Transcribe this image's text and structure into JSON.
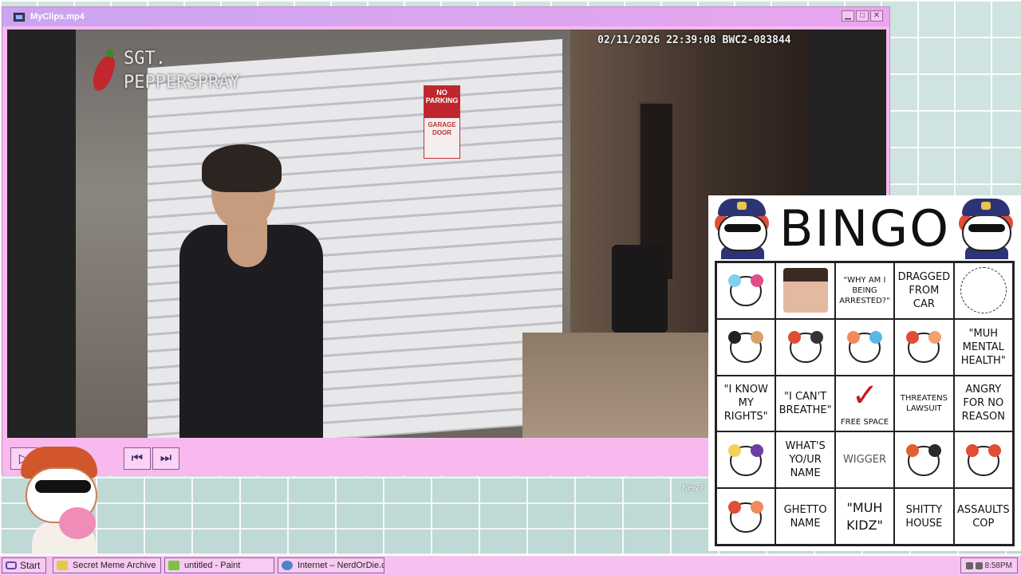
{
  "window": {
    "title": "MyClips.mp4",
    "controls": {
      "minimize": "▁",
      "maximize": "□",
      "close": "✕"
    }
  },
  "video": {
    "watermark_line1": "SGT.",
    "watermark_line2": "PEPPERSPRAY",
    "timestamp": "02/11/2026 22:39:08 BWC2-083844",
    "sign_top": "NO PARKING",
    "sign_bottom": "GARAGE DOOR"
  },
  "player_controls": {
    "play_icon": "▷",
    "prev_icon": "⏮",
    "next_icon": "⏭"
  },
  "bingo": {
    "title": "BINGO",
    "free_space_label": "FREE SPACE",
    "cells": [
      {
        "type": "image",
        "icon": "cat-sticker-pink"
      },
      {
        "type": "image",
        "icon": "crying-woman-photo"
      },
      {
        "type": "text",
        "style": "small",
        "text": "\"WHY AM I BEING ARRESTED?\""
      },
      {
        "type": "text",
        "style": "normal",
        "text": "DRAGGED FROM CAR"
      },
      {
        "type": "image",
        "icon": "sketch-drawing"
      },
      {
        "type": "image",
        "icon": "cat-sticker-black-hair"
      },
      {
        "type": "image",
        "icon": "cat-sticker-steering-wheel"
      },
      {
        "type": "image",
        "icon": "cat-sticker-orange-hair"
      },
      {
        "type": "image",
        "icon": "cat-sticker-calico"
      },
      {
        "type": "text",
        "style": "normal",
        "text": "\"MUH MENTAL HEALTH\""
      },
      {
        "type": "text",
        "style": "normal",
        "text": "\"I KNOW MY RIGHTS\""
      },
      {
        "type": "text",
        "style": "normal",
        "text": "\"I CAN'T BREATHE\""
      },
      {
        "type": "free",
        "icon": "free-space-check"
      },
      {
        "type": "text",
        "style": "small",
        "text": "THREATENS LAWSUIT"
      },
      {
        "type": "text",
        "style": "normal",
        "text": "ANGRY FOR NO REASON"
      },
      {
        "type": "image",
        "icon": "cat-sticker-blonde"
      },
      {
        "type": "text",
        "style": "normal",
        "text": "WHAT'S YO/UR NAME"
      },
      {
        "type": "text",
        "style": "light",
        "text": "WIGGER"
      },
      {
        "type": "image",
        "icon": "cat-sticker-dark"
      },
      {
        "type": "image",
        "icon": "cat-sticker-red"
      },
      {
        "type": "image",
        "icon": "cat-sticker-sitting"
      },
      {
        "type": "text",
        "style": "normal",
        "text": "GHETTO NAME"
      },
      {
        "type": "text",
        "style": "big",
        "text": "\"MUH KIDZ\""
      },
      {
        "type": "text",
        "style": "normal",
        "text": "SHITTY HOUSE"
      },
      {
        "type": "text",
        "style": "normal",
        "text": "ASSAULTS COP"
      }
    ]
  },
  "desktop": {
    "folder_hint": "New F"
  },
  "taskbar": {
    "start_label": "Start",
    "tasks": [
      {
        "label": "Secret Meme Archive",
        "icon": "folder-icon",
        "color": "#e6c84b"
      },
      {
        "label": "untitled - Paint",
        "icon": "paint-icon",
        "color": "#7bc443"
      },
      {
        "label": "Internet – NerdOrDie.com",
        "icon": "globe-icon",
        "color": "#4a84c9"
      }
    ],
    "clock": "8:58PM"
  }
}
